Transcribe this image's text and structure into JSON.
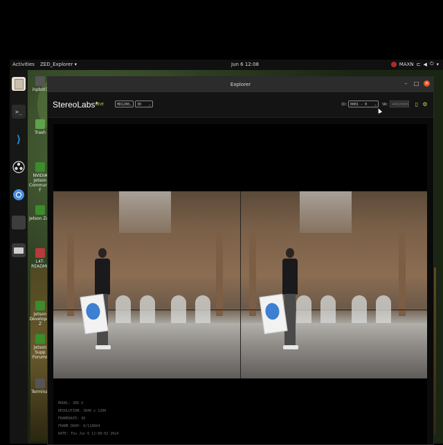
{
  "topbar": {
    "activities": "Activities",
    "app_menu": "ZED_Explorer ▾",
    "clock": "Jun 6 12:08",
    "maxn": "MAXN"
  },
  "desktop_icons": [
    {
      "label": "inpbot3",
      "color": "#4a4a4a"
    },
    {
      "label": "Trash",
      "color": "#5da34b"
    },
    {
      "label": "NVIDIA Jetson Community F",
      "color": "#3b8c2a"
    },
    {
      "label": "Jetson Zoo",
      "color": "#3b8c2a"
    },
    {
      "label": "L4T-README",
      "color": "#b83a3a"
    },
    {
      "label": "Jetson Developer Z",
      "color": "#3b8c2a"
    },
    {
      "label": "Jetson Supp Forums",
      "color": "#3b8c2a"
    },
    {
      "label": "Terminal",
      "color": "#555555"
    }
  ],
  "window": {
    "title": "Explorer",
    "brand": "StereoLabs*",
    "live": "LIVE",
    "resolution": "HD1200",
    "fps": "30",
    "id_label": "ID:",
    "id_value": "0001 - 0",
    "sn_label": "SN:",
    "sn_placeholder": "44820806"
  },
  "metadata": {
    "model": "MODEL: ZED X",
    "resolution": "RESOLUTION: 3840 x 1200",
    "framerate": "FRAMERATE: 30",
    "frame_drop": "FRAME DROP: 0/118894",
    "date": "DATE: Thu Jun 6 12:08:02 2024"
  },
  "colors": {
    "accent": "#c8d44a",
    "close_button": "#e95420",
    "window_bg": "#0a0a0a"
  }
}
